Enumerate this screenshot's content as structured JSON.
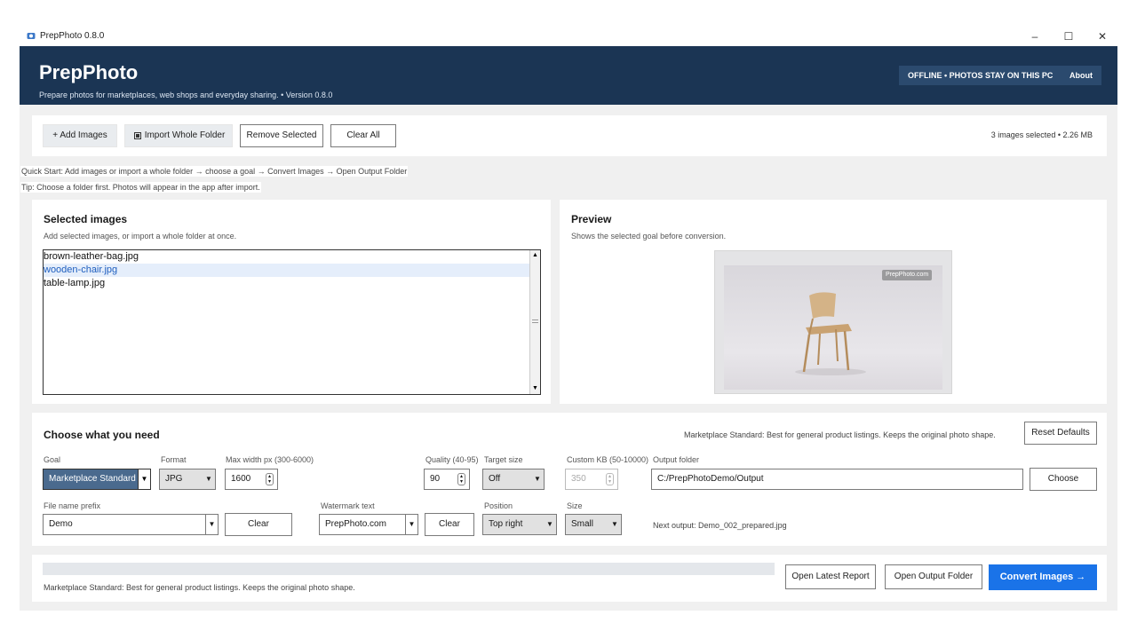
{
  "window": {
    "title": "PrepPhoto 0.8.0",
    "minimize": "–",
    "maximize": "☐",
    "close": "✕"
  },
  "header": {
    "brand": "PrepPhoto",
    "subtitle": "Prepare photos for marketplaces, web shops and everyday sharing.  •  Version 0.8.0",
    "offline_badge": "OFFLINE  •  PHOTOS STAY ON THIS PC",
    "about": "About"
  },
  "toolbar": {
    "add_images": "+   Add Images",
    "import_folder": "Import Whole Folder",
    "remove_selected": "Remove Selected",
    "clear_all": "Clear All",
    "summary": "3 images selected • 2.26 MB"
  },
  "tips": {
    "quick_start": "Quick Start: Add images or import a whole folder → choose a goal → Convert Images → Open Output Folder",
    "tip": "Tip: Choose a folder first. Photos will appear in the app after import."
  },
  "images_panel": {
    "title": "Selected images",
    "hint": "Add selected images, or import a whole folder at once.",
    "files": [
      {
        "name": "brown-leather-bag.jpg",
        "selected": false
      },
      {
        "name": "wooden-chair.jpg",
        "selected": true
      },
      {
        "name": "table-lamp.jpg",
        "selected": false
      }
    ]
  },
  "preview": {
    "title": "Preview",
    "hint": "Shows the selected goal before conversion.",
    "watermark": "PrepPhoto.com"
  },
  "options": {
    "title": "Choose what you need",
    "goal_desc": "Marketplace Standard: Best for general product listings. Keeps the original photo shape.",
    "reset": "Reset Defaults",
    "goal_label": "Goal",
    "goal_value": "Marketplace Standard",
    "format_label": "Format",
    "format_value": "JPG",
    "maxwidth_label": "Max width px (300-6000)",
    "maxwidth_value": "1600",
    "quality_label": "Quality (40-95)",
    "quality_value": "90",
    "target_label": "Target size",
    "target_value": "Off",
    "customkb_label": "Custom KB (50-10000)",
    "customkb_value": "350",
    "output_label": "Output folder",
    "output_value": "C:/PrepPhotoDemo/Output",
    "choose": "Choose",
    "prefix_label": "File name prefix",
    "prefix_value": "Demo",
    "clear": "Clear",
    "wm_label": "Watermark text",
    "wm_value": "PrepPhoto.com",
    "position_label": "Position",
    "position_value": "Top right",
    "size_label": "Size",
    "size_value": "Small",
    "next_output": "Next output: Demo_002_prepared.jpg"
  },
  "footer": {
    "status": "Marketplace Standard: Best for general product listings. Keeps the original photo shape.",
    "open_report": "Open Latest Report",
    "open_output": "Open Output Folder",
    "convert": "Convert Images  →",
    "progress_fraction": 0
  },
  "colors": {
    "header_bg": "#1b3554",
    "accent": "#1a73e8",
    "selected_row": "#e5eefb"
  }
}
